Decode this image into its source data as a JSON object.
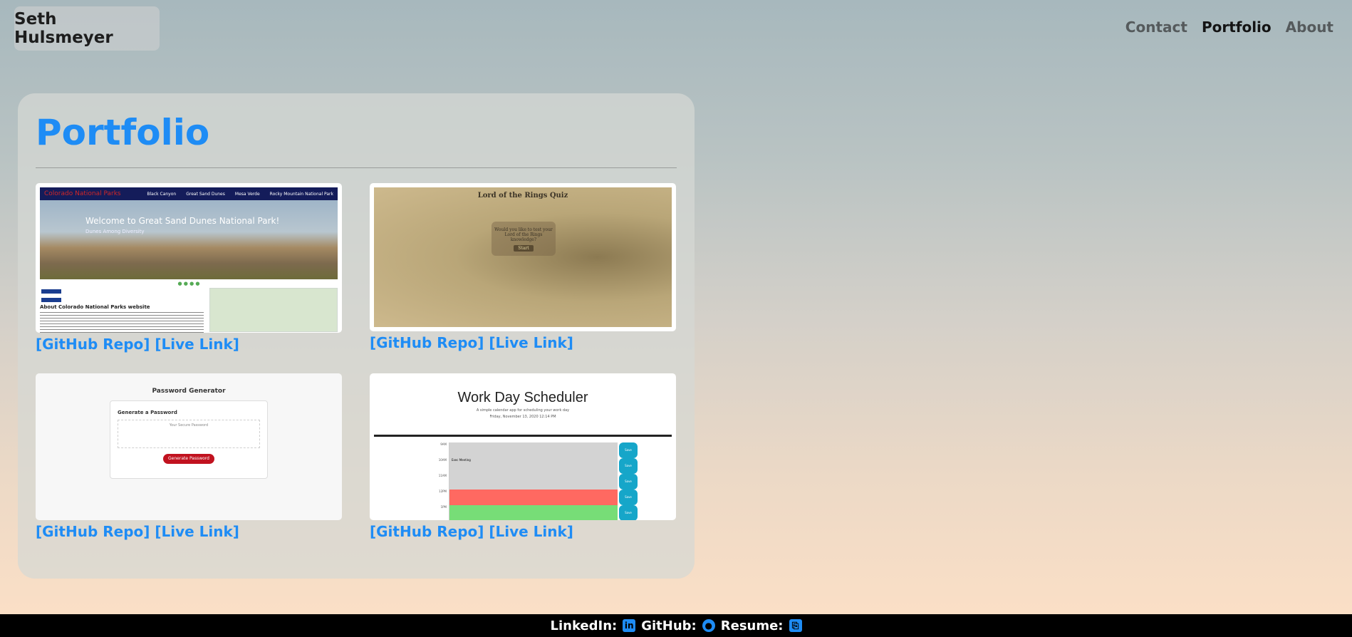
{
  "header": {
    "brand": "Seth Hulsmeyer",
    "nav": [
      {
        "label": "Contact"
      },
      {
        "label": "Portfolio"
      },
      {
        "label": "About"
      }
    ]
  },
  "portfolio": {
    "title": "Portfolio",
    "projects": [
      {
        "github_label": "[GitHub Repo]",
        "live_label": "[Live Link]",
        "thumb": {
          "site_name": "Colorado National Parks",
          "menu": [
            "Black Canyon",
            "Great Sand Dunes",
            "Mesa Verde",
            "Rocky Mountain National Park"
          ],
          "hero_title": "Welcome to Great Sand Dunes National Park!",
          "hero_sub": "Dunes Among Diversity",
          "about_heading": "About Colorado National Parks website"
        }
      },
      {
        "github_label": "[GitHub Repo]",
        "live_label": "[Live Link]",
        "thumb": {
          "title": "Lord of the Rings Quiz",
          "question": "Would you like to test your Lord of the Rings knowledge?",
          "button": "Start"
        }
      },
      {
        "github_label": "[GitHub Repo]",
        "live_label": "[Live Link]",
        "thumb": {
          "title": "Password Generator",
          "card_heading": "Generate a Password",
          "placeholder": "Your Secure Password",
          "button": "Generate Password"
        }
      },
      {
        "github_label": "[GitHub Repo]",
        "live_label": "[Live Link]",
        "thumb": {
          "title": "Work Day Scheduler",
          "subtitle": "A simple calendar app for scheduling your work day",
          "date": "Friday, November 13, 2020 12:14 PM",
          "rows": [
            {
              "hour": "9AM",
              "text": "",
              "state": "past"
            },
            {
              "hour": "10AM",
              "text": "Exec Meeting",
              "state": "past"
            },
            {
              "hour": "11AM",
              "text": "",
              "state": "past"
            },
            {
              "hour": "12PM",
              "text": "",
              "state": "present"
            },
            {
              "hour": "1PM",
              "text": "",
              "state": "future"
            }
          ],
          "save_label": "Save"
        }
      }
    ]
  },
  "footer": {
    "linkedin_label": "LinkedIn:",
    "github_label": "GitHub:",
    "resume_label": "Resume:"
  },
  "colors": {
    "accent": "#1e8cf5",
    "footer_bg": "#000000",
    "past": "#d3d3d3",
    "present": "#ff6961",
    "future": "#77dd77"
  }
}
